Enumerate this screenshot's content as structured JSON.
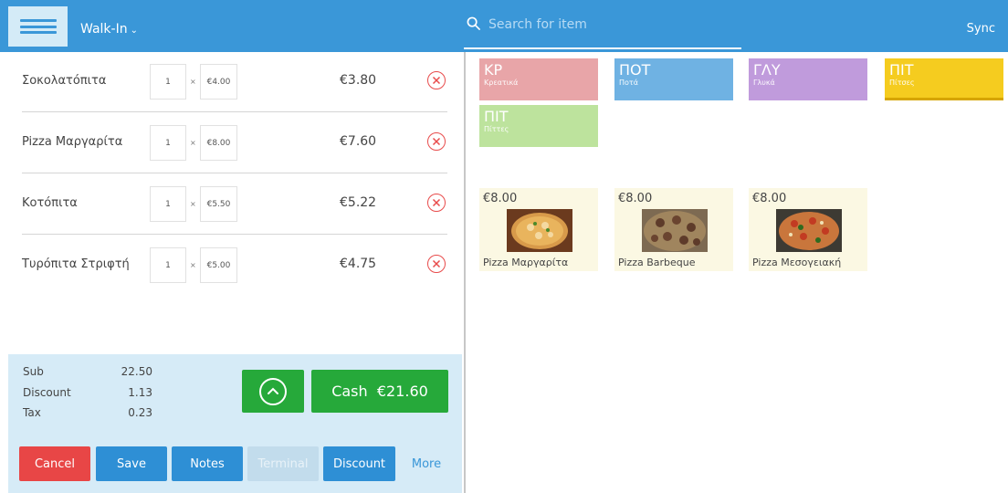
{
  "header": {
    "order_type": "Walk-In",
    "search_placeholder": "Search for item",
    "sync_label": "Sync"
  },
  "order": {
    "items": [
      {
        "name": "Σοκολατόπιτα",
        "qty": "1",
        "unit_price": "€4.00",
        "total": "€3.80"
      },
      {
        "name": "Pizza Μαργαρίτα",
        "qty": "1",
        "unit_price": "€8.00",
        "total": "€7.60"
      },
      {
        "name": "Κοτόπιτα",
        "qty": "1",
        "unit_price": "€5.50",
        "total": "€5.22"
      },
      {
        "name": "Τυρόπιτα Στριφτή",
        "qty": "1",
        "unit_price": "€5.00",
        "total": "€4.75"
      }
    ],
    "times_symbol": "×"
  },
  "totals": {
    "sub_label": "Sub",
    "sub_value": "22.50",
    "discount_label": "Discount",
    "discount_value": "1.13",
    "tax_label": "Tax",
    "tax_value": "0.23",
    "cash_label": "Cash  €21.60"
  },
  "actions": {
    "cancel": "Cancel",
    "save": "Save",
    "notes": "Notes",
    "terminal": "Terminal",
    "discount": "Discount",
    "more": "More"
  },
  "categories": [
    {
      "code": "ΚΡ",
      "name": "Κρεατικά",
      "color": "#e8a5a8"
    },
    {
      "code": "ΠΟΤ",
      "name": "Ποτά",
      "color": "#6fb2e3"
    },
    {
      "code": "ΓΛΥ",
      "name": "Γλυκά",
      "color": "#c09bdc"
    },
    {
      "code": "ΠΙΤ",
      "name": "Πίτσες",
      "color": "#f5cc1f"
    },
    {
      "code": "ΠΙΤ",
      "name": "Πίττες",
      "color": "#bde39d"
    }
  ],
  "products": [
    {
      "price": "€8.00",
      "name": "Pizza Μαργαρίτα"
    },
    {
      "price": "€8.00",
      "name": "Pizza Barbeque"
    },
    {
      "price": "€8.00",
      "name": "Pizza Μεσογειακή"
    }
  ],
  "colors": {
    "header": "#3a97d8",
    "cash": "#26a93a",
    "cancel": "#e84646",
    "primary_button": "#2e8fd5"
  }
}
